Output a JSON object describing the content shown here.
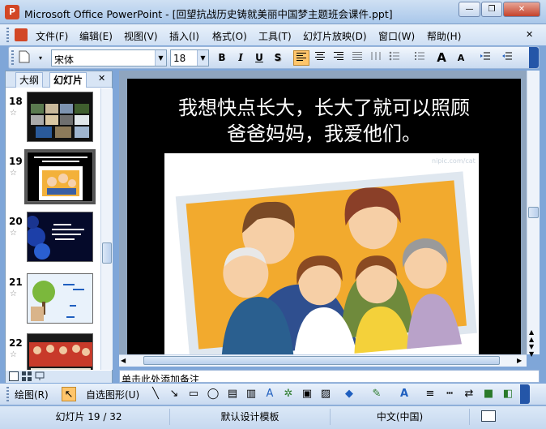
{
  "window": {
    "title": "Microsoft Office PowerPoint - [回望抗战历史铸就美丽中国梦主题班会课件.ppt]",
    "minimize_glyph": "—",
    "restore_glyph": "❐",
    "close_glyph": "✕"
  },
  "menu": {
    "items": [
      "文件(F)",
      "编辑(E)",
      "视图(V)",
      "插入(I)",
      "格式(O)",
      "工具(T)",
      "幻灯片放映(D)",
      "窗口(W)",
      "帮助(H)"
    ],
    "close_glyph": "✕"
  },
  "toolbar": {
    "font_name": "宋体",
    "font_size": "18",
    "bold": "B",
    "italic": "I",
    "underline": "U",
    "shadow": "S",
    "grow_font": "A",
    "shrink_font": "A"
  },
  "left_panel": {
    "tab_outline": "大纲",
    "tab_slides": "幻灯片",
    "close_glyph": "✕",
    "slides": [
      {
        "number": "18"
      },
      {
        "number": "19",
        "selected": true
      },
      {
        "number": "20"
      },
      {
        "number": "21"
      },
      {
        "number": "22"
      }
    ],
    "star_glyph": "☆"
  },
  "slide": {
    "title_line1": "我想快点长大，长大了就可以照顾",
    "title_line2": "爸爸妈妈，我爱他们。",
    "watermark": "nipic.com/cat"
  },
  "notes": {
    "placeholder": "单击此处添加备注"
  },
  "draw_toolbar": {
    "draw_label": "绘图(R)",
    "autoshapes_label": "自选图形(U)"
  },
  "status": {
    "slide_position": "幻灯片 19 / 32",
    "design_template": "默认设计模板",
    "language": "中文(中国)"
  },
  "colors": {
    "titlebar_top": "#cfe0f3",
    "slide_background": "#000000",
    "selection_highlight": "#ffc56b"
  }
}
